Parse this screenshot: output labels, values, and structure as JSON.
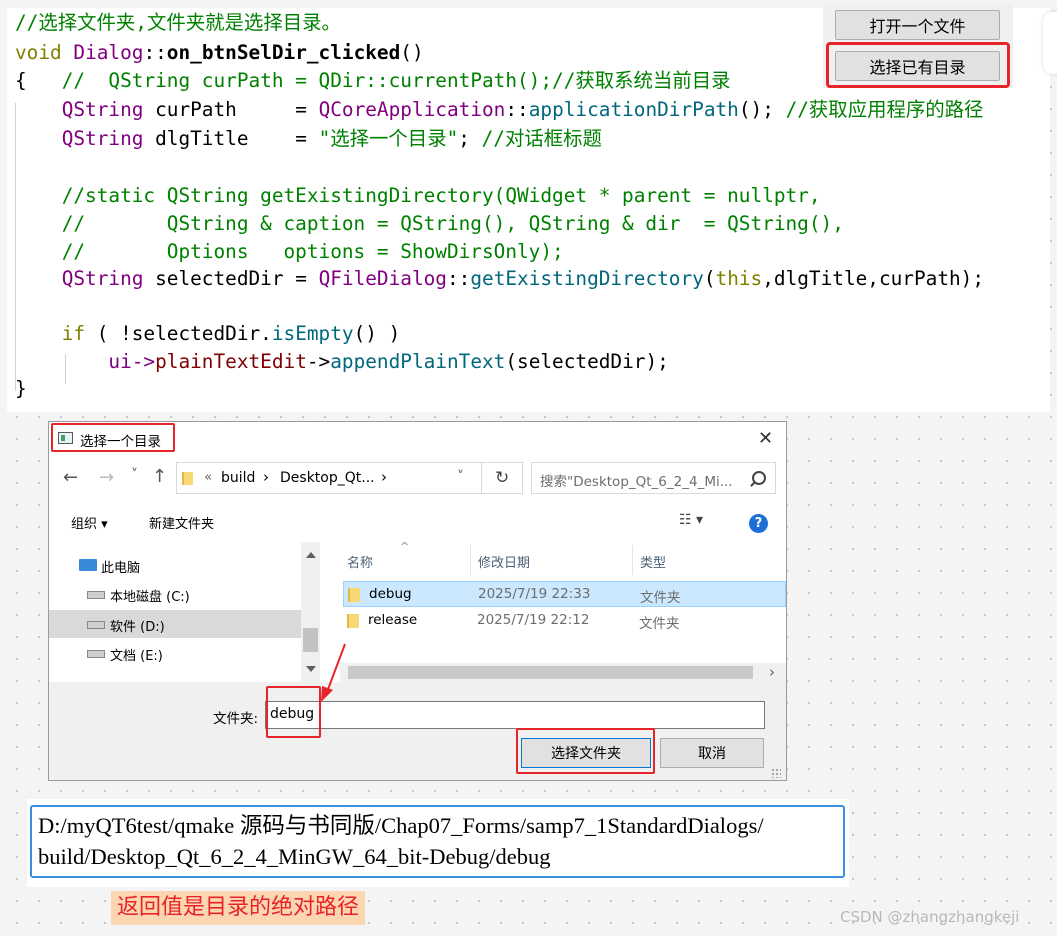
{
  "code": {
    "l1": "//选择文件夹,文件夹就是选择目录。",
    "l2_void": "void",
    "l2_cls": "Dialog",
    "l2_sep": "::",
    "l2_fn": "on_btnSelDir_clicked",
    "l2_paren": "()",
    "l3_brace": "{",
    "l3_comment": "//  QString curPath = QDir::currentPath();//获取系统当前目录",
    "l4_type": "QString",
    "l4_var": " curPath     = ",
    "l4_cls": "QCoreApplication",
    "l4_sep": "::",
    "l4_fn": "applicationDirPath",
    "l4_end": "(); ",
    "l4_comment": "//获取应用程序的路径",
    "l5_type": "QString",
    "l5_var": " dlgTitle    = ",
    "l5_str": "\"选择一个目录\"",
    "l5_end": "; ",
    "l5_comment": "//对话框标题",
    "l6": "//static QString getExistingDirectory(QWidget * parent = nullptr,",
    "l7": "//       QString & caption = QString(), QString & dir  = QString(),",
    "l8": "//       Options   options = ShowDirsOnly);",
    "l9_type": "QString",
    "l9_var": " selectedDir = ",
    "l9_cls": "QFileDialog",
    "l9_sep": "::",
    "l9_fn": "getExistingDirectory",
    "l9_open": "(",
    "l9_this": "this",
    "l9_args": ",dlgTitle,curPath);",
    "l10_if": "if",
    "l10_a": " ( !selectedDir.",
    "l10_fn": "isEmpty",
    "l10_b": "() )",
    "l11_ui": "ui->",
    "l11_member": "plainTextEdit",
    "l11_arrow": "->",
    "l11_fn": "appendPlainText",
    "l11_args": "(selectedDir);",
    "l12_brace": "}"
  },
  "buttons": {
    "open_file": "打开一个文件",
    "select_dir": "选择已有目录"
  },
  "dialog": {
    "title": "选择一个目录",
    "close_glyph": "✕",
    "back_glyph": "←",
    "forward_glyph": "→",
    "recent_glyph": "˅",
    "up_glyph": "↑",
    "breadcrumb_prefix": "«",
    "breadcrumb_1": "build",
    "breadcrumb_sep": "›",
    "breadcrumb_2": "Desktop_Qt...",
    "breadcrumb_more": "›",
    "addr_dropdown": "˅",
    "refresh_glyph": "↻",
    "search_placeholder": "搜索\"Desktop_Qt_6_2_4_Mi...",
    "organize": "组织 ▾",
    "new_folder": "新建文件夹",
    "view_glyph": "☷ ▾",
    "help_glyph": "?",
    "nav": [
      "此电脑",
      "本地磁盘 (C:)",
      "软件 (D:)",
      "文档 (E:)"
    ],
    "columns": {
      "name": "名称",
      "date": "修改日期",
      "type": "类型"
    },
    "sort_glyph": "^",
    "rows": [
      {
        "name": "debug",
        "date": "2025/7/19 22:33",
        "type": "文件夹"
      },
      {
        "name": "release",
        "date": "2025/7/19 22:12",
        "type": "文件夹"
      }
    ],
    "folder_label": "文件夹:",
    "folder_value": "debug",
    "select_button": "选择文件夹",
    "cancel_button": "取消"
  },
  "output_path": {
    "line1": "D:/myQT6test/qmake 源码与书同版/Chap07_Forms/samp7_1StandardDialogs/",
    "line2": "build/Desktop_Qt_6_2_4_MinGW_64_bit-Debug/debug"
  },
  "annotation": "返回值是目录的绝对路径",
  "watermark": "CSDN @zhangzhangkeji",
  "colors": {
    "highlight": "#e8242b",
    "comment": "#008000",
    "selection": "#cce8ff",
    "output_border": "#3c8fe0"
  }
}
